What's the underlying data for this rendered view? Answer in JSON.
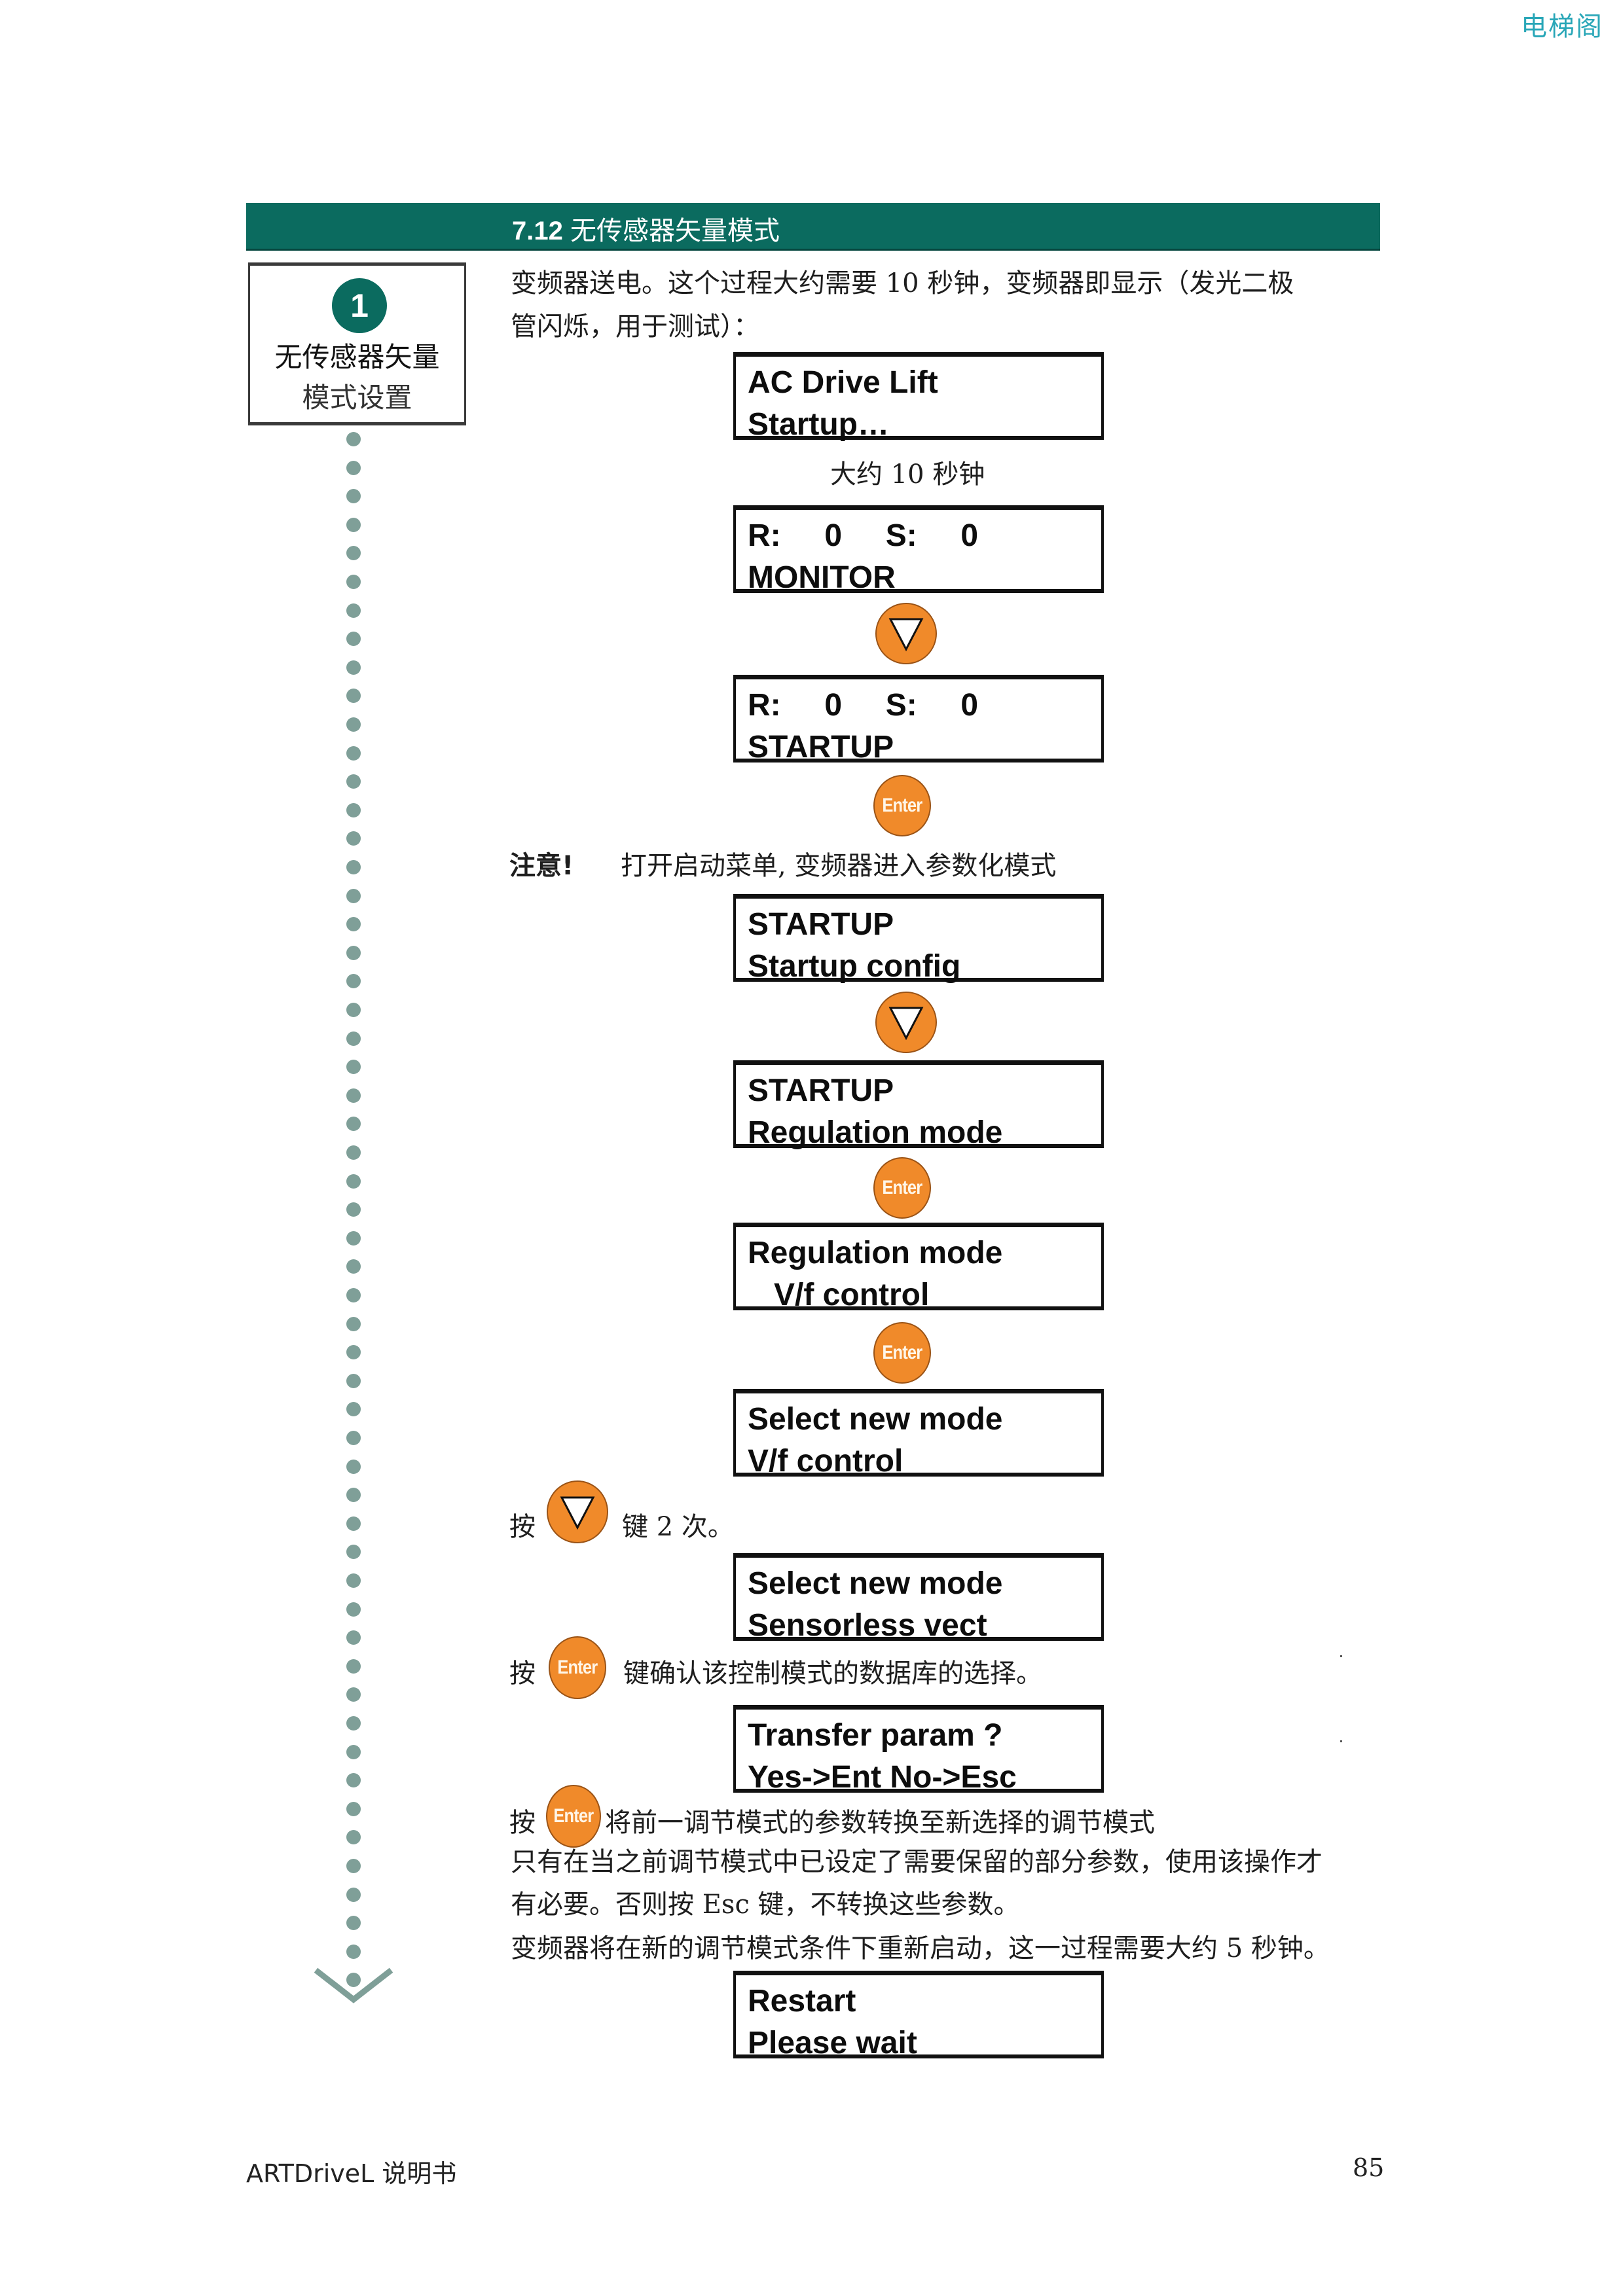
{
  "watermark": "电梯阁",
  "section": {
    "number": "7.12",
    "title": "无传感器矢量模式"
  },
  "step": {
    "number": "1",
    "label_line1": "无传感器矢量",
    "label_line2": "模式设置"
  },
  "intro": {
    "line1": "变频器送电。这个过程大约需要 10 秒钟，变频器即显示（发光二极",
    "line2": "管闪烁，用于测试）："
  },
  "displays": [
    {
      "line1": "AC Drive Lift",
      "line2": "Startup…"
    },
    {
      "line1": "R:     0     S:     0",
      "line2": "MONITOR"
    },
    {
      "line1": "R:     0     S:     0",
      "line2": "STARTUP"
    },
    {
      "line1": "STARTUP",
      "line2": "Startup config"
    },
    {
      "line1": "STARTUP",
      "line2": "Regulation mode"
    },
    {
      "line1": "Regulation mode",
      "line2": "   V/f control"
    },
    {
      "line1": "Select new mode",
      "line2": "V/f control"
    },
    {
      "line1": "Select new mode",
      "line2": "Sensorless vect"
    },
    {
      "line1": "Transfer param ?",
      "line2": "Yes->Ent No->Esc"
    },
    {
      "line1": "Restart",
      "line2": "Please wait"
    }
  ],
  "wait_caption": "大约 10 秒钟",
  "keys": {
    "down_icon": "down-triangle-icon",
    "enter_label": "Enter"
  },
  "note": {
    "label": "注意!",
    "text": "打开启动菜单, 变频器进入参数化模式"
  },
  "instructions": {
    "press": "按",
    "down_twice": "键 2 次。",
    "confirm": "键确认该控制模式的数据库的选择。",
    "transfer": "将前一调节模式的参数转换至新选择的调节模式",
    "only_if_1": "只有在当之前调节模式中已设定了需要保留的部分参数，使用该操作才",
    "only_if_2": "有必要。否则按 Esc 键，不转换这些参数。",
    "restart": "变频器将在新的调节模式条件下重新启动，这一过程需要大约 5 秒钟。"
  },
  "footer": {
    "manual": "ARTDriveL 说明书",
    "page": "85"
  },
  "colors": {
    "header_green": "#0b6b5f",
    "key_orange": "#f08a2a",
    "watermark_cyan": "#2aa7b8",
    "dot_gray_green": "#7f9f98"
  }
}
